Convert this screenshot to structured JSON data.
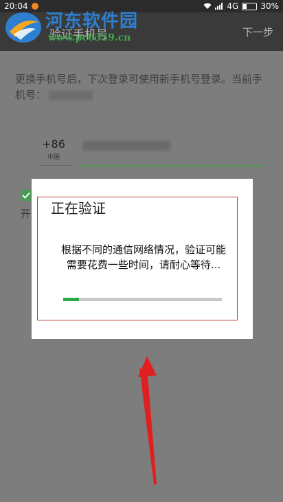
{
  "status_bar": {
    "time": "20:04",
    "network": "4G",
    "battery_percent": "30%",
    "battery_level": 0.3
  },
  "header": {
    "title": "验证手机号",
    "next_label": "下一步"
  },
  "watermark": {
    "name": "河东软件园",
    "url": "www.pc0359.cn"
  },
  "content": {
    "description": "更换手机号后，下次登录可使用新手机号登录。当前手机号：",
    "country_code": "+86",
    "country_name": "中国",
    "checkbox_label": "开"
  },
  "dialog": {
    "title": "正在验证",
    "message": "根据不同的通信网络情况，验证可能需要花费一些时间，请耐心等待...",
    "progress": 0.1
  },
  "colors": {
    "accent_green": "#2aa84a",
    "annotation_red": "#e02020",
    "watermark_blue": "#2e7fd0"
  }
}
